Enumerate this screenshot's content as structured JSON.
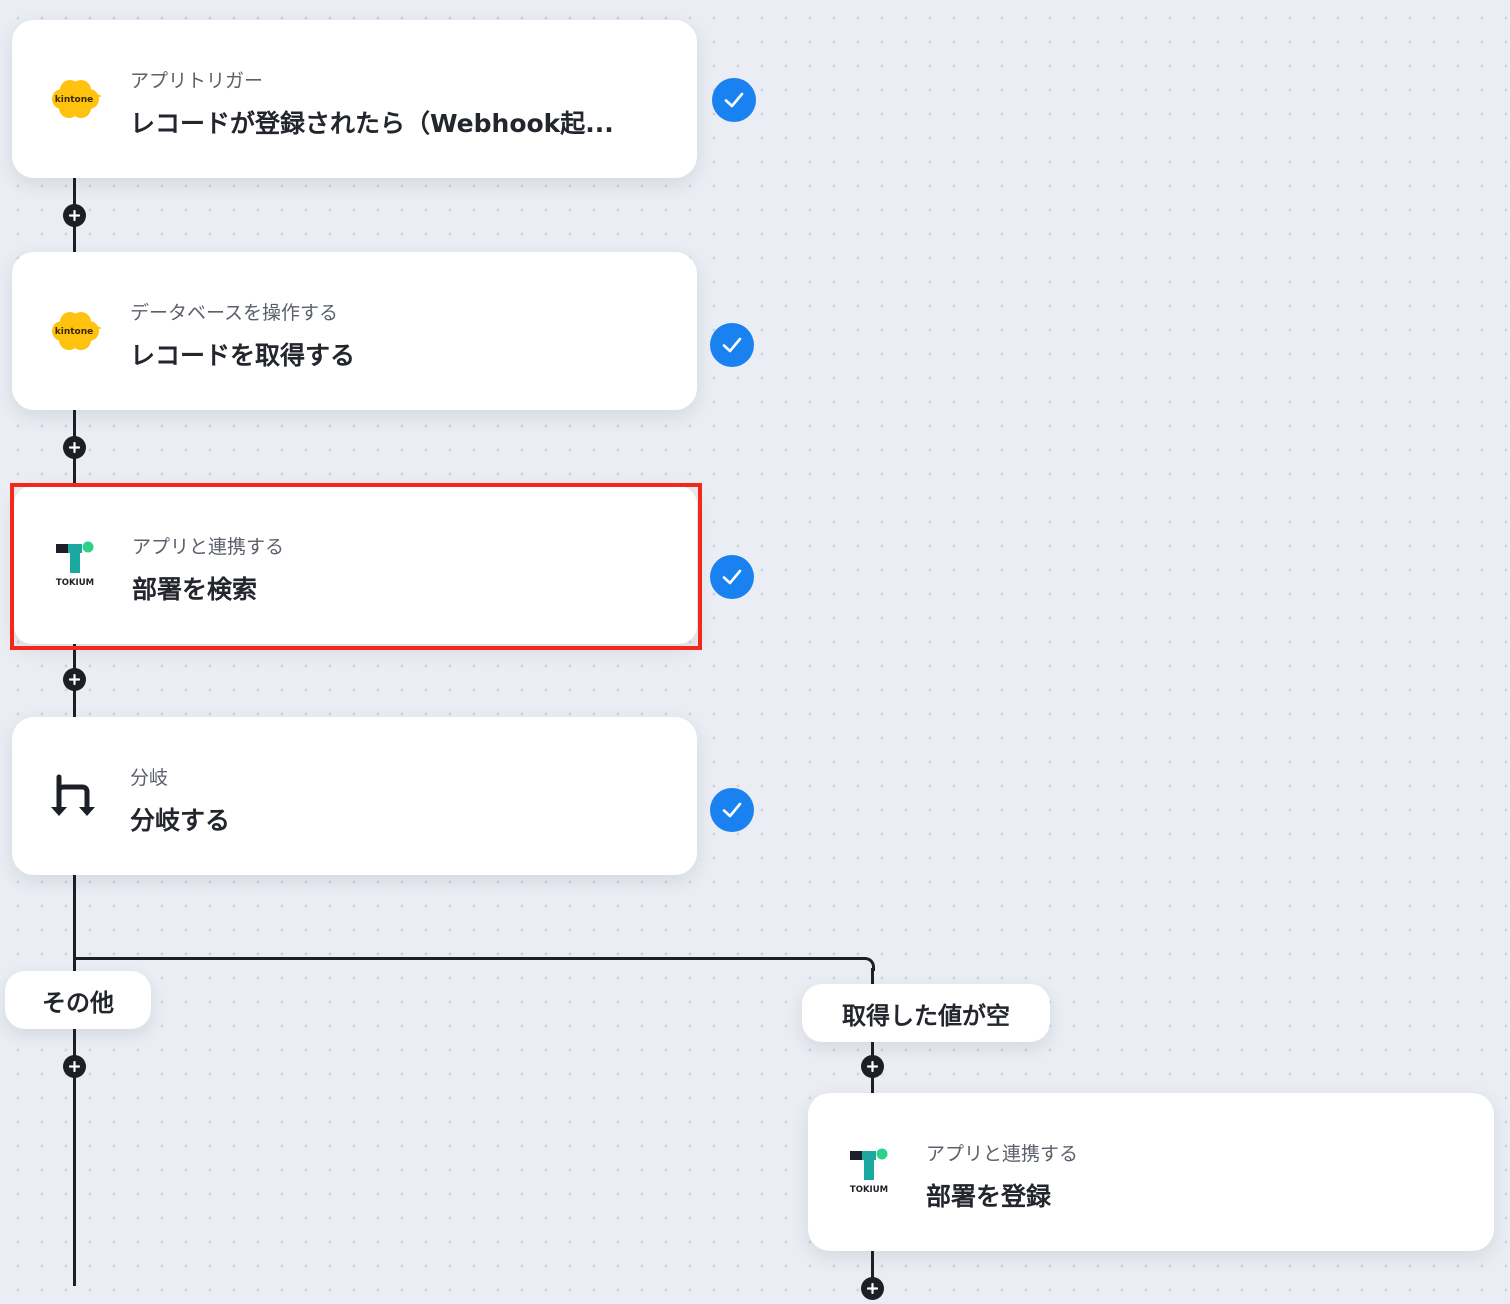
{
  "flow": {
    "steps": [
      {
        "category": "アプリトリガー",
        "title": "レコードが登録されたら（Webhook起...",
        "app_icon": "kintone-icon",
        "app_label": "kintone",
        "completed": true
      },
      {
        "category": "データベースを操作する",
        "title": "レコードを取得する",
        "app_icon": "kintone-icon",
        "app_label": "kintone",
        "completed": true
      },
      {
        "category": "アプリと連携する",
        "title": "部署を検索",
        "app_icon": "tokium-icon",
        "app_label": "TOKIUM",
        "completed": true,
        "highlighted": true
      },
      {
        "category": "分岐",
        "title": "分岐する",
        "app_icon": "branch-icon",
        "completed": true
      }
    ],
    "branches": {
      "other_label": "その他",
      "empty_label": "取得した値が空"
    },
    "branch_step": {
      "category": "アプリと連携する",
      "title": "部署を登録",
      "app_icon": "tokium-icon",
      "app_label": "TOKIUM"
    },
    "colors": {
      "check": "#1a82f0",
      "highlight": "#f2291a",
      "connector": "#1c1f26",
      "kintone": "#ffc20e",
      "tokium_teal": "#1aa8a0",
      "tokium_green": "#2fd08a"
    }
  }
}
